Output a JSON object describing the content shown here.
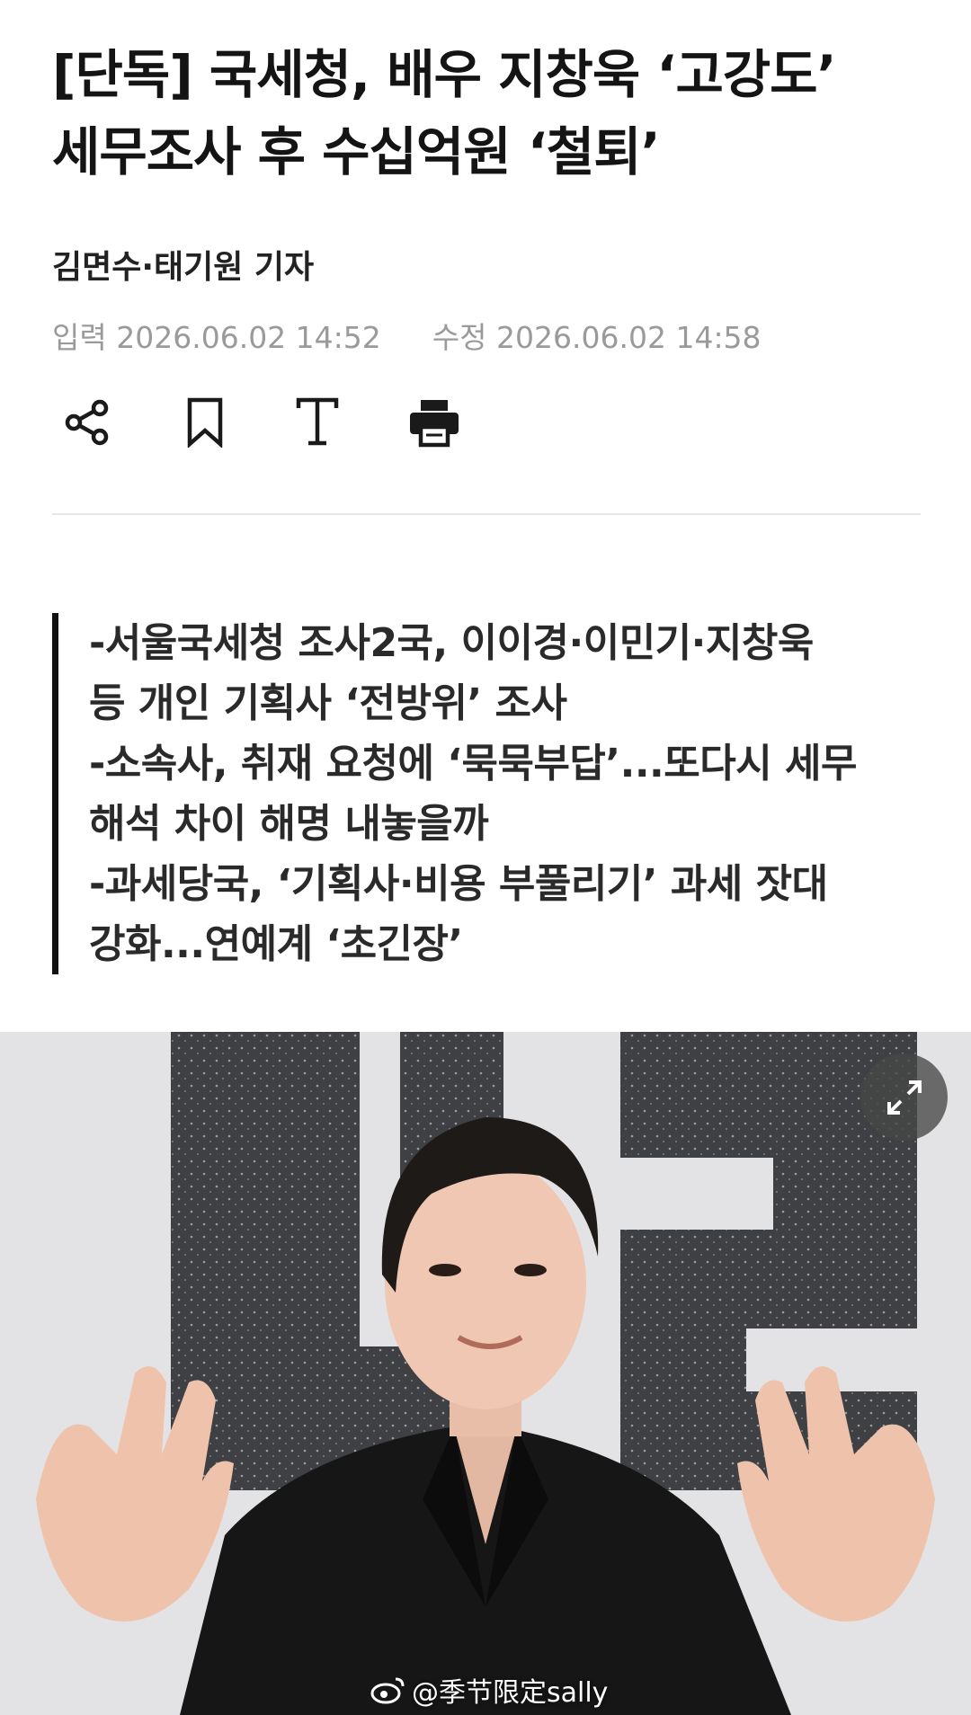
{
  "article": {
    "headline_line1": "[단독] 국세청, 배우 지창욱 ‘고강도’",
    "headline_line2": "세무조사 후 수십억원 ‘철퇴’",
    "byline": "김면수·태기원 기자",
    "input_label": "입력",
    "input_date": "2026.06.02 14:52",
    "modified_label": "수정",
    "modified_date": "2026.06.02 14:58"
  },
  "toolbar": {
    "icons": [
      "share-icon",
      "bookmark-icon",
      "font-size-icon",
      "print-icon"
    ]
  },
  "summary": {
    "lines": [
      "-서울국세청 조사2국, 이이경·이민기·지창욱",
      "등 개인 기획사 ‘전방위’ 조사",
      "-소속사, 취재 요청에 ‘묵묵부답’...또다시 세무",
      "해석 차이 해명 내놓을까",
      "-과세당국, ‘기획사·비용 부풀리기’ 과세 잣대",
      "강화...연예계 ‘초긴장’"
    ]
  },
  "photo": {
    "expand_icon": "expand-icon",
    "watermark": "@季节限定sally"
  },
  "colors": {
    "headline": "#141414",
    "date_gray": "#9a9a9a",
    "divider": "#e6e6e6",
    "summary_bar": "#111111"
  }
}
